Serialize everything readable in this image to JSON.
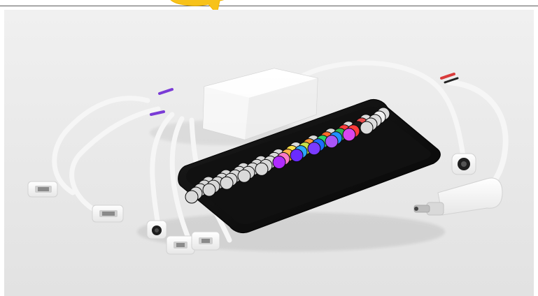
{
  "image": {
    "subject": "rgb-led-controller-kit",
    "objects": [
      "controller-box",
      "ir-remote",
      "connector-cables",
      "dc-jack-cable",
      "power-jack-cable"
    ],
    "colors": {
      "background": "#e7e7e7",
      "plastic": "#f4f4f4",
      "remote_body": "#121212",
      "badge": "#f7c21a"
    },
    "remote_buttons": [
      "#d9d9d9",
      "#d9d9d9",
      "#d9d9d9",
      "#d9d9d9",
      "#d9d9d9",
      "#d9d9d9",
      "#d9d9d9",
      "#d9d9d9",
      "#d9d9d9",
      "#dcdcdc",
      "#dcdcdc",
      "#d9d9d9",
      "#d9d9d9",
      "#d9d9d9",
      "#d9d9d9",
      "#d9d9d9",
      "#ffe14a",
      "#ff9a32",
      "#ff6a2a",
      "#ff3b3b",
      "#e84d4d",
      "#f0f0f0",
      "#d9d9d9",
      "#d9d9d9",
      "#d9d9d9",
      "#d9d9d9",
      "#d9d9d9",
      "#ffb347",
      "#c7e34a",
      "#2bd46a",
      "#32b34c",
      "#1a1a1a",
      "#dcdcdc",
      "#d9d9d9",
      "#d9d9d9",
      "#d9d9d9",
      "#d9d9d9",
      "#d9d9d9",
      "#ff7ac8",
      "#2aa7ff",
      "#1d6dff",
      "#1e90ff",
      "#ff3b3b",
      "#dcdcdc",
      "#d9d9d9",
      "#d9d9d9",
      "#d9d9d9",
      "#d9d9d9",
      "#d9d9d9",
      "#b02bff",
      "#6a2bff",
      "#7b3bff",
      "#a855f7",
      "#d946ef",
      "#dcdcdc"
    ]
  }
}
